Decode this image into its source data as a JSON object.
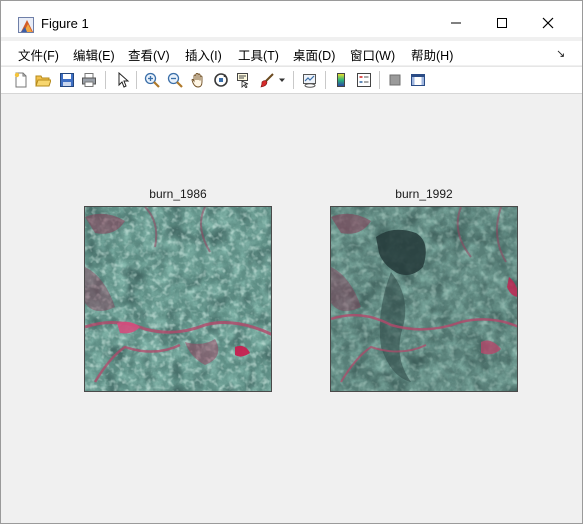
{
  "window": {
    "title": "Figure 1"
  },
  "menu": {
    "items": [
      "文件(F)",
      "编辑(E)",
      "查看(V)",
      "插入(I)",
      "工具(T)",
      "桌面(D)",
      "窗口(W)",
      "帮助(H)"
    ],
    "overflow_icon": "dock-arrow-icon"
  },
  "toolbar": {
    "icons": [
      "new-figure-icon",
      "open-file-icon",
      "save-icon",
      "print-icon",
      "edit-plot-arrow-icon",
      "zoom-in-icon",
      "zoom-out-icon",
      "pan-hand-icon",
      "rotate-3d-icon",
      "data-cursor-icon",
      "brush-icon",
      "brush-dropdown-icon",
      "link-plot-icon",
      "colorbar-icon",
      "legend-icon",
      "hide-plot-tools-icon",
      "show-plot-tools-icon"
    ]
  },
  "axes": [
    {
      "title": "burn_1986"
    },
    {
      "title": "burn_1992"
    }
  ],
  "colors": {
    "vegetation": "#6aa79a",
    "burn_scar": "#3b5a57",
    "bare_soil": "#b4476a",
    "bright_patch": "#d9f2ea"
  }
}
